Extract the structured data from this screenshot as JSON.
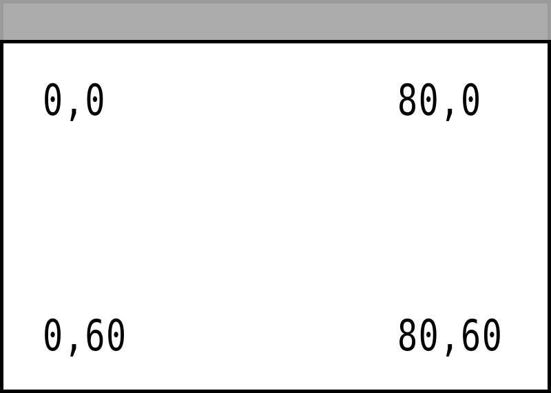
{
  "window": {
    "title": ""
  },
  "labels": {
    "top_left": "0,0",
    "top_right": "80,0",
    "bottom_left": "0,60",
    "bottom_right": "80,60"
  },
  "colors": {
    "titlebar": "#ababab",
    "titlebar_border": "#9a9a9a",
    "frame": "#000000",
    "background": "#ffffff"
  }
}
